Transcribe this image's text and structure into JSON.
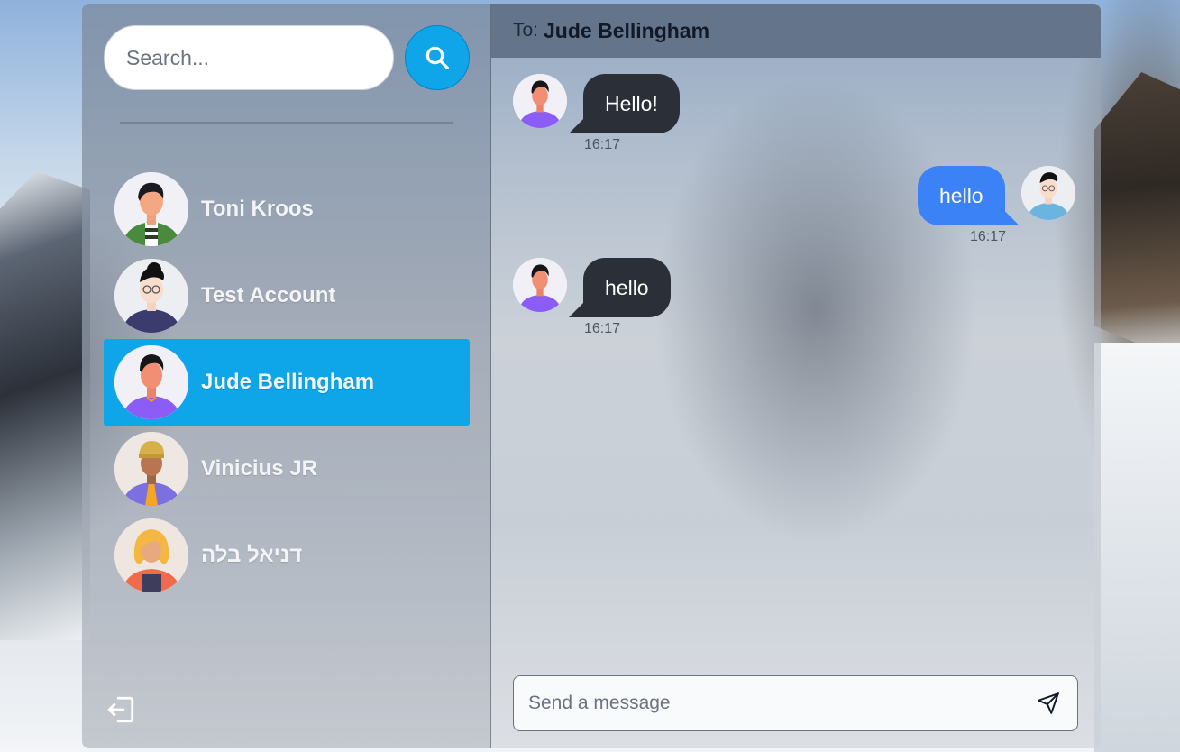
{
  "sidebar": {
    "search_placeholder": "Search...",
    "contacts": [
      {
        "name": "Toni Kroos",
        "avatar": "avatar-green-striped-shirt"
      },
      {
        "name": "Test Account",
        "avatar": "avatar-glasses-navy-shirt"
      },
      {
        "name": "Jude Bellingham",
        "avatar": "avatar-purple-shirt",
        "active": true
      },
      {
        "name": "Vinicius JR",
        "avatar": "avatar-beanie-purple-jacket"
      },
      {
        "name": "דניאל בלה",
        "avatar": "avatar-blonde-apron"
      }
    ],
    "logout_icon": "logout-icon"
  },
  "chat": {
    "to_label": "To:",
    "to_name": "Jude Bellingham",
    "messages": [
      {
        "direction": "in",
        "text": "Hello!",
        "time": "16:17"
      },
      {
        "direction": "out",
        "text": "hello",
        "time": "16:17"
      },
      {
        "direction": "in",
        "text": "hello",
        "time": "16:17"
      }
    ],
    "composer_placeholder": "Send a message",
    "send_icon": "send-icon"
  },
  "colors": {
    "accent": "#0ea5e9",
    "outgoing_bubble": "#3b82f6",
    "incoming_bubble": "#2b3038",
    "header": "#64748b"
  }
}
